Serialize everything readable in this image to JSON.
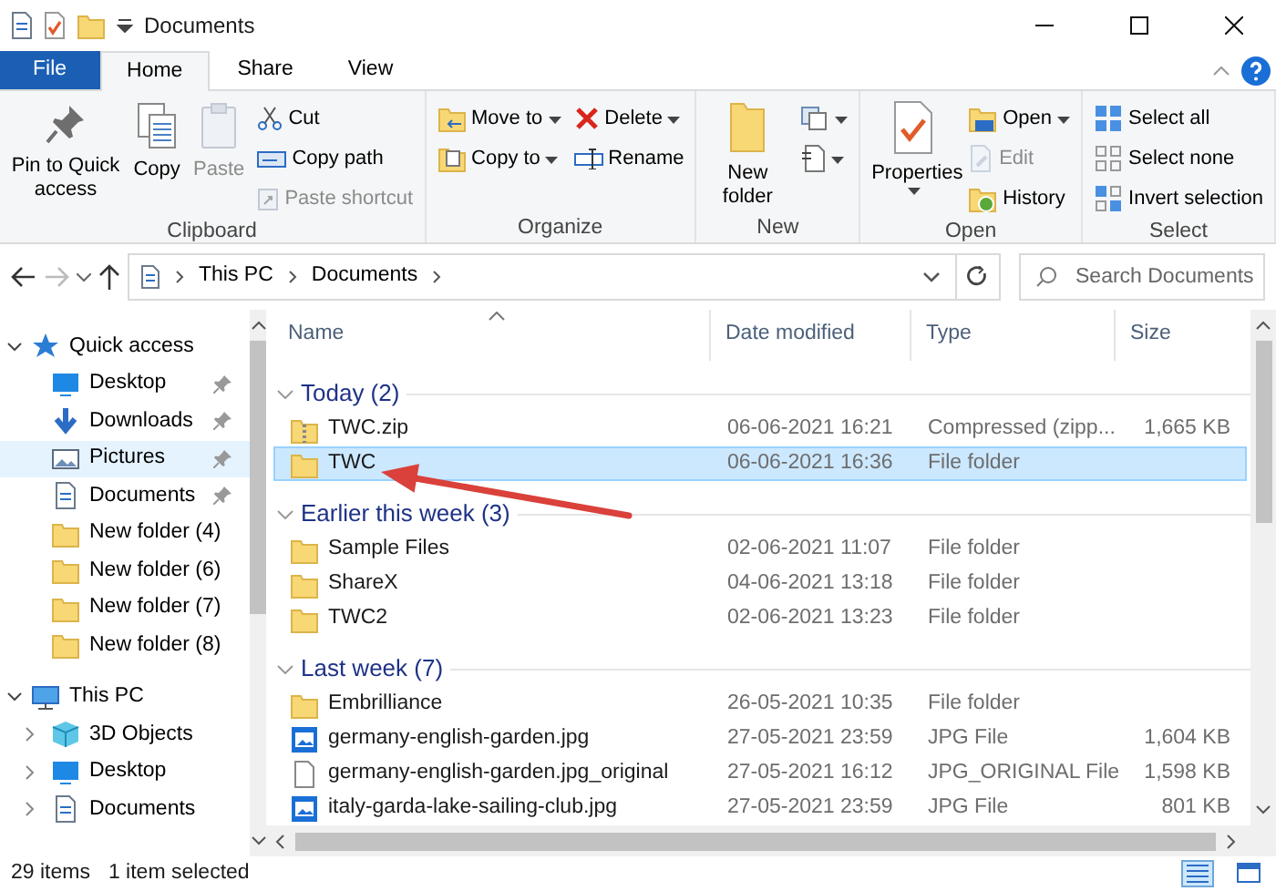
{
  "window": {
    "title": "Documents"
  },
  "ribbon": {
    "tabs": [
      {
        "label": "File",
        "kind": "file",
        "selected": false
      },
      {
        "label": "Home",
        "kind": "tab",
        "selected": true
      },
      {
        "label": "Share",
        "kind": "tab",
        "selected": false
      },
      {
        "label": "View",
        "kind": "tab",
        "selected": false
      }
    ],
    "groups": [
      {
        "label": "Clipboard",
        "columns": [
          {
            "kind": "large",
            "label": "Pin to Quick access",
            "disabled": false,
            "dropdown": false
          },
          {
            "kind": "large",
            "label": "Copy",
            "disabled": false,
            "dropdown": false
          },
          {
            "kind": "large",
            "label": "Paste",
            "disabled": true,
            "dropdown": false
          },
          {
            "kind": "small",
            "items": [
              {
                "label": "Cut",
                "disabled": false,
                "dropdown": false
              },
              {
                "label": "Copy path",
                "disabled": false,
                "dropdown": false
              },
              {
                "label": "Paste shortcut",
                "disabled": true,
                "dropdown": false
              }
            ]
          }
        ]
      },
      {
        "label": "Organize",
        "columns": [
          {
            "kind": "small",
            "items": [
              {
                "label": "Move to",
                "disabled": false,
                "dropdown": true
              },
              {
                "label": "Copy to",
                "disabled": false,
                "dropdown": true
              }
            ]
          },
          {
            "kind": "small",
            "items": [
              {
                "label": "Delete",
                "disabled": false,
                "dropdown": true
              },
              {
                "label": "Rename",
                "disabled": false,
                "dropdown": false
              }
            ]
          }
        ]
      },
      {
        "label": "New",
        "columns": [
          {
            "kind": "large",
            "label": "New folder",
            "disabled": false,
            "dropdown": false
          },
          {
            "kind": "small",
            "items": [
              {
                "disabled": false,
                "dropdown": true
              },
              {
                "disabled": false,
                "dropdown": true
              }
            ]
          }
        ]
      },
      {
        "label": "Open",
        "columns": [
          {
            "kind": "large",
            "label": "Properties",
            "disabled": false,
            "dropdown": true
          },
          {
            "kind": "small",
            "items": [
              {
                "label": "Open",
                "disabled": false,
                "dropdown": true
              },
              {
                "label": "Edit",
                "disabled": true,
                "dropdown": false
              },
              {
                "label": "History",
                "disabled": false,
                "dropdown": false
              }
            ]
          }
        ]
      },
      {
        "label": "Select",
        "columns": [
          {
            "kind": "small",
            "items": [
              {
                "label": "Select all",
                "disabled": false,
                "dropdown": false
              },
              {
                "label": "Select none",
                "disabled": false,
                "dropdown": false
              },
              {
                "label": "Invert selection",
                "disabled": false,
                "dropdown": false
              }
            ]
          }
        ]
      }
    ]
  },
  "address_bar": {
    "path": [
      "This PC",
      "Documents"
    ],
    "search": {
      "placeholder": "Search Documents"
    }
  },
  "sidebar": {
    "items": [
      {
        "label": "Quick access",
        "kind": "quick",
        "expanded": true,
        "children": [
          {
            "label": "Desktop",
            "kind": "desktop",
            "pinned": true,
            "selected": false
          },
          {
            "label": "Downloads",
            "kind": "downloads",
            "pinned": true,
            "selected": false
          },
          {
            "label": "Pictures",
            "kind": "pictures",
            "pinned": true,
            "selected": true
          },
          {
            "label": "Documents",
            "kind": "documents",
            "pinned": true,
            "selected": false
          },
          {
            "label": "New folder (4)",
            "kind": "folder",
            "pinned": false,
            "selected": false
          },
          {
            "label": "New folder (6)",
            "kind": "folder",
            "pinned": false,
            "selected": false
          },
          {
            "label": "New folder (7)",
            "kind": "folder",
            "pinned": false,
            "selected": false
          },
          {
            "label": "New folder (8)",
            "kind": "folder",
            "pinned": false,
            "selected": false
          }
        ]
      },
      {
        "label": "This PC",
        "kind": "pc",
        "expanded": true,
        "children": [
          {
            "label": "3D Objects",
            "kind": "objects",
            "expanded": false,
            "selected": false
          },
          {
            "label": "Desktop",
            "kind": "desktop",
            "expanded": false,
            "selected": false
          },
          {
            "label": "Documents",
            "kind": "documents",
            "expanded": false,
            "selected": false
          }
        ]
      }
    ]
  },
  "file_list": {
    "columns": [
      {
        "label": "Name",
        "sorted": true
      },
      {
        "label": "Date modified",
        "sorted": false
      },
      {
        "label": "Type",
        "sorted": false
      },
      {
        "label": "Size",
        "sorted": false
      }
    ],
    "groups": [
      {
        "label": "Today (2)",
        "expanded": true,
        "rows": [
          {
            "kind": "zip",
            "name": "TWC.zip",
            "date": "06-06-2021 16:21",
            "type": "Compressed (zipp...",
            "size": "1,665 KB",
            "selected": false
          },
          {
            "kind": "folder",
            "name": "TWC",
            "date": "06-06-2021 16:36",
            "type": "File folder",
            "selected": true
          }
        ]
      },
      {
        "label": "Earlier this week (3)",
        "expanded": true,
        "rows": [
          {
            "kind": "folder",
            "name": "Sample Files",
            "date": "02-06-2021 11:07",
            "type": "File folder",
            "selected": false
          },
          {
            "kind": "folder",
            "name": "ShareX",
            "date": "04-06-2021 13:18",
            "type": "File folder",
            "selected": false
          },
          {
            "kind": "folder",
            "name": "TWC2",
            "date": "02-06-2021 13:23",
            "type": "File folder",
            "selected": false
          }
        ]
      },
      {
        "label": "Last week (7)",
        "expanded": true,
        "rows": [
          {
            "kind": "folder",
            "name": "Embrilliance",
            "date": "26-05-2021 10:35",
            "type": "File folder",
            "selected": false
          },
          {
            "kind": "image",
            "name": "germany-english-garden.jpg",
            "date": "27-05-2021 23:59",
            "type": "JPG File",
            "size": "1,604 KB",
            "selected": false
          },
          {
            "kind": "file",
            "name": "germany-english-garden.jpg_original",
            "date": "27-05-2021 16:12",
            "type": "JPG_ORIGINAL File",
            "size": "1,598 KB",
            "selected": false
          },
          {
            "kind": "image",
            "name": "italy-garda-lake-sailing-club.jpg",
            "date": "27-05-2021 23:59",
            "type": "JPG File",
            "size": "801 KB",
            "selected": false
          }
        ]
      }
    ]
  },
  "status_bar": {
    "item_count": "29 items",
    "selection": "1 item selected",
    "views": [
      {
        "kind": "details",
        "selected": true
      },
      {
        "kind": "icons",
        "selected": false
      }
    ]
  }
}
